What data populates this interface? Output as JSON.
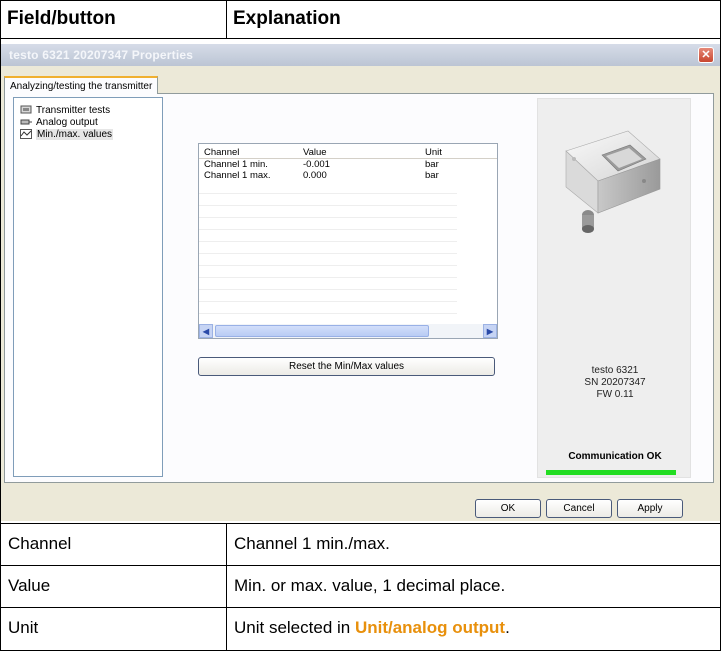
{
  "table": {
    "headers": [
      "Field/button",
      "Explanation"
    ],
    "rows": [
      {
        "field": "Channel",
        "explanation": "Channel 1 min./max."
      },
      {
        "field": "Value",
        "explanation": "Min. or max. value, 1 decimal place."
      },
      {
        "field": "Unit",
        "explanation_prefix": "Unit selected in ",
        "explanation_link": "Unit/analog output",
        "explanation_suffix": "."
      }
    ]
  },
  "dialog": {
    "title": "testo 6321  20207347 Properties",
    "tab": "Analyzing/testing the transmitter",
    "tree": [
      {
        "label": "Transmitter tests",
        "icon": "transmitter-tests-icon"
      },
      {
        "label": "Analog output",
        "icon": "analog-output-icon"
      },
      {
        "label": "Min./max. values",
        "icon": "min-max-values-icon",
        "selected": true
      }
    ],
    "grid": {
      "columns": [
        "Channel",
        "Value",
        "Unit"
      ],
      "rows": [
        {
          "channel": "Channel 1 min.",
          "value": "-0.001",
          "unit": "bar"
        },
        {
          "channel": "Channel 1 max.",
          "value": "0.000",
          "unit": "bar"
        }
      ]
    },
    "reset_button": "Reset the Min/Max values",
    "device": {
      "model": "testo 6321",
      "serial": "SN 20207347",
      "firmware": "FW  0.11",
      "status": "Communication OK",
      "status_color": "#22dd22"
    },
    "buttons": {
      "ok": "OK",
      "cancel": "Cancel",
      "apply": "Apply"
    }
  },
  "colors": {
    "link": "#e8900c"
  }
}
